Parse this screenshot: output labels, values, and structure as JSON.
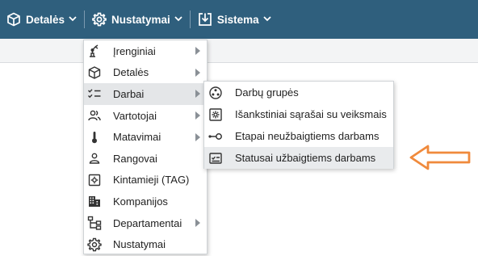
{
  "topnav": {
    "items": [
      {
        "label": "Detalės",
        "icon": "cube-icon"
      },
      {
        "label": "Nustatymai",
        "icon": "gear-icon"
      },
      {
        "label": "Sistema",
        "icon": "download-box-icon"
      }
    ]
  },
  "menu": {
    "items": [
      {
        "label": "Įrenginiai",
        "icon": "robot-arm-icon",
        "has_submenu": true
      },
      {
        "label": "Detalės",
        "icon": "cube-icon",
        "has_submenu": true
      },
      {
        "label": "Darbai",
        "icon": "checklist-icon",
        "has_submenu": true,
        "active": true
      },
      {
        "label": "Vartotojai",
        "icon": "users-icon",
        "has_submenu": true
      },
      {
        "label": "Matavimai",
        "icon": "thermometer-icon",
        "has_submenu": true
      },
      {
        "label": "Rangovai",
        "icon": "user-icon",
        "has_submenu": false
      },
      {
        "label": "Kintamieji (TAG)",
        "icon": "tag-box-icon",
        "has_submenu": false
      },
      {
        "label": "Kompanijos",
        "icon": "building-icon",
        "has_submenu": false
      },
      {
        "label": "Departamentai",
        "icon": "org-chart-icon",
        "has_submenu": true
      },
      {
        "label": "Nustatymai",
        "icon": "gear-icon",
        "has_submenu": false
      }
    ]
  },
  "submenu": {
    "items": [
      {
        "label": "Darbų grupės",
        "icon": "group-circle-icon"
      },
      {
        "label": "Išankstiniai sąrašai su veiksmais",
        "icon": "gear-box-icon"
      },
      {
        "label": "Etapai neužbaigtiems darbams",
        "icon": "key-line-icon"
      },
      {
        "label": "Statusai užbaigtiems darbams",
        "icon": "status-card-icon",
        "highlighted": true
      }
    ]
  },
  "annotation": {
    "color": "#f08a3c",
    "icon": "left-arrow-annotation-icon"
  },
  "colors": {
    "topbar": "#2f5f7d",
    "menu_active": "#e4e6e8"
  }
}
